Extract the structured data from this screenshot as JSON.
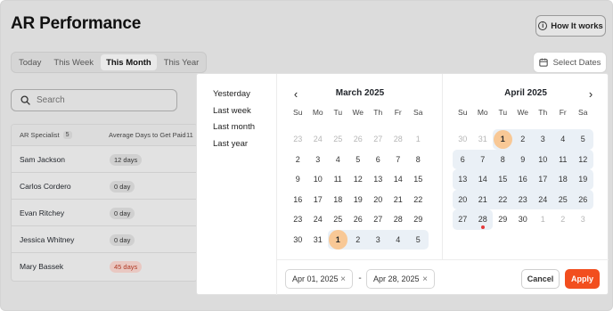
{
  "page": {
    "title": "AR Performance",
    "how_it_works": "How It works",
    "how_icon": "info-circle-icon",
    "tabs": [
      "Today",
      "This Week",
      "This Month",
      "This Year"
    ],
    "active_tab": "This Month",
    "search_placeholder": "Search"
  },
  "table": {
    "headers": {
      "name": "AR Specialist",
      "count": "5",
      "days": "Average Days to Get Paid",
      "extra": "11"
    },
    "rows": [
      {
        "name": "Sam Jackson",
        "days": "12 days",
        "status": "normal"
      },
      {
        "name": "Carlos Cordero",
        "days": "0 day",
        "status": "normal"
      },
      {
        "name": "Evan Ritchey",
        "days": "0 day",
        "status": "normal"
      },
      {
        "name": "Jessica Whitney",
        "days": "0 day",
        "status": "normal"
      },
      {
        "name": "Mary Bassek",
        "days": "45 days",
        "status": "overdue"
      }
    ]
  },
  "datepicker": {
    "trigger_label": "Select Dates",
    "trigger_icon": "calendar-icon",
    "presets": [
      "Yesterday",
      "Last week",
      "Last month",
      "Last year"
    ],
    "weekdays": [
      "Su",
      "Mo",
      "Tu",
      "We",
      "Th",
      "Fr",
      "Sa"
    ],
    "left": {
      "title": "March 2025",
      "nav_icon": "chevron-left-icon",
      "days": [
        {
          "d": "23",
          "m": true
        },
        {
          "d": "24",
          "m": true
        },
        {
          "d": "25",
          "m": true
        },
        {
          "d": "26",
          "m": true
        },
        {
          "d": "27",
          "m": true
        },
        {
          "d": "28",
          "m": true
        },
        {
          "d": "1",
          "m": true
        },
        {
          "d": "2"
        },
        {
          "d": "3"
        },
        {
          "d": "4"
        },
        {
          "d": "5"
        },
        {
          "d": "6"
        },
        {
          "d": "7"
        },
        {
          "d": "8"
        },
        {
          "d": "9"
        },
        {
          "d": "10"
        },
        {
          "d": "11"
        },
        {
          "d": "12"
        },
        {
          "d": "13"
        },
        {
          "d": "14"
        },
        {
          "d": "15"
        },
        {
          "d": "16"
        },
        {
          "d": "17"
        },
        {
          "d": "18"
        },
        {
          "d": "19"
        },
        {
          "d": "20"
        },
        {
          "d": "21"
        },
        {
          "d": "22"
        },
        {
          "d": "23"
        },
        {
          "d": "24"
        },
        {
          "d": "25"
        },
        {
          "d": "26"
        },
        {
          "d": "27"
        },
        {
          "d": "28"
        },
        {
          "d": "29"
        },
        {
          "d": "30"
        },
        {
          "d": "31"
        },
        {
          "d": "1",
          "start": true,
          "range": true
        },
        {
          "d": "2",
          "range": true
        },
        {
          "d": "3",
          "range": true
        },
        {
          "d": "4",
          "range": true
        },
        {
          "d": "5",
          "range": true
        }
      ]
    },
    "right": {
      "title": "April 2025",
      "nav_icon": "chevron-right-icon",
      "days": [
        {
          "d": "30",
          "m": true
        },
        {
          "d": "31",
          "m": true
        },
        {
          "d": "1",
          "start": true,
          "range": true
        },
        {
          "d": "2",
          "range": true
        },
        {
          "d": "3",
          "range": true
        },
        {
          "d": "4",
          "range": true
        },
        {
          "d": "5",
          "range": true
        },
        {
          "d": "6",
          "range": true
        },
        {
          "d": "7",
          "range": true
        },
        {
          "d": "8",
          "range": true
        },
        {
          "d": "9",
          "range": true
        },
        {
          "d": "10",
          "range": true
        },
        {
          "d": "11",
          "range": true
        },
        {
          "d": "12",
          "range": true
        },
        {
          "d": "13",
          "range": true
        },
        {
          "d": "14",
          "range": true
        },
        {
          "d": "15",
          "range": true
        },
        {
          "d": "16",
          "range": true
        },
        {
          "d": "17",
          "range": true
        },
        {
          "d": "18",
          "range": true
        },
        {
          "d": "19",
          "range": true
        },
        {
          "d": "20",
          "range": true
        },
        {
          "d": "21",
          "range": true
        },
        {
          "d": "22",
          "range": true
        },
        {
          "d": "23",
          "range": true
        },
        {
          "d": "24",
          "range": true
        },
        {
          "d": "25",
          "range": true
        },
        {
          "d": "26",
          "range": true
        },
        {
          "d": "27",
          "range": true
        },
        {
          "d": "28",
          "range": true,
          "today": true
        },
        {
          "d": "29"
        },
        {
          "d": "30"
        },
        {
          "d": "1",
          "m": true
        },
        {
          "d": "2",
          "m": true
        },
        {
          "d": "3",
          "m": true
        }
      ]
    },
    "start_value": "Apr 01, 2025",
    "end_value": "Apr 28, 2025",
    "separator": "-",
    "clear_icon": "close-icon",
    "cancel_label": "Cancel",
    "apply_label": "Apply",
    "colors": {
      "accent": "#f24e1e",
      "range": "#eaf0f6",
      "selected": "#f8c896",
      "today_dot": "#e5393a"
    }
  }
}
